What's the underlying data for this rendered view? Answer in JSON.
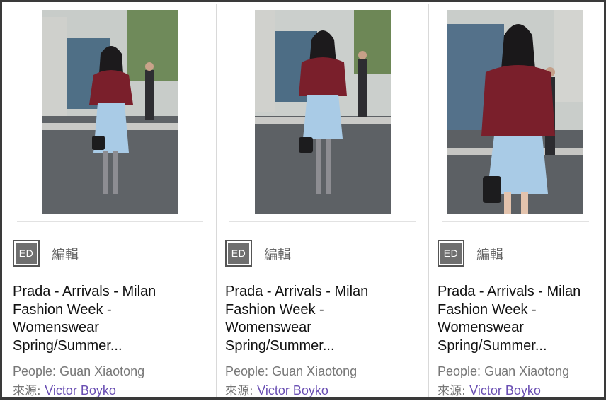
{
  "cards": [
    {
      "badge": "ED",
      "editor_label": "編輯",
      "title": "Prada - Arrivals - Milan Fashion Week - Womenswear Spring/Summer...",
      "people_prefix": "People: ",
      "people": "Guan Xiaotong",
      "source_prefix": "來源: ",
      "source": "Victor Boyko"
    },
    {
      "badge": "ED",
      "editor_label": "編輯",
      "title": "Prada - Arrivals - Milan Fashion Week - Womenswear Spring/Summer...",
      "people_prefix": "People: ",
      "people": "Guan Xiaotong",
      "source_prefix": "來源: ",
      "source": "Victor Boyko"
    },
    {
      "badge": "ED",
      "editor_label": "編輯",
      "title": "Prada - Arrivals - Milan Fashion Week - Womenswear Spring/Summer...",
      "people_prefix": "People: ",
      "people": "Guan Xiaotong",
      "source_prefix": "來源: ",
      "source": "Victor Boyko"
    }
  ],
  "colors": {
    "sweater": "#7a1f2b",
    "skirt": "#a9cbe6",
    "link": "#6a4fb3",
    "badge": "#6f6f6f"
  }
}
